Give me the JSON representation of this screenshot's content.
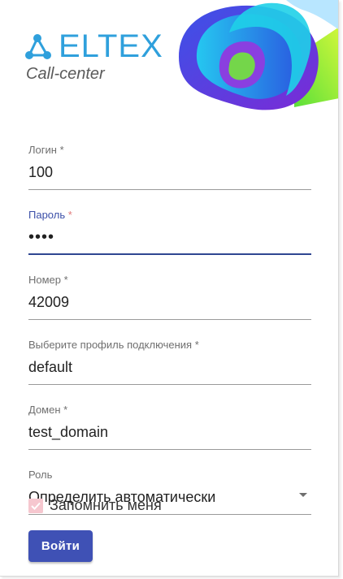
{
  "brand": {
    "name": "ELTEX",
    "subtitle": "Call-center"
  },
  "form": {
    "login": {
      "label": "Логин",
      "required_mark": "*",
      "value": "100"
    },
    "password": {
      "label": "Пароль",
      "required_mark": "*",
      "value": "••••"
    },
    "number": {
      "label": "Номер",
      "required_mark": "*",
      "value": "42009"
    },
    "profile": {
      "label": "Выберите профиль подключения",
      "required_mark": "*",
      "value": "default"
    },
    "domain": {
      "label": "Домен",
      "required_mark": "*",
      "value": "test_domain"
    },
    "role": {
      "label": "Роль",
      "selected": "Определить автоматически"
    },
    "remember": {
      "label": "Запомнить меня",
      "checked": true
    },
    "submit_label": "Войти"
  },
  "colors": {
    "accent": "#3f51b5",
    "brand_blue": "#2fa0dc",
    "focus_line": "#2f4691",
    "checkbox_fill": "#f6c7cf"
  },
  "icons": {
    "logo": "eltex-network-logo-icon",
    "dropdown": "chevron-down-icon",
    "check": "check-icon"
  }
}
